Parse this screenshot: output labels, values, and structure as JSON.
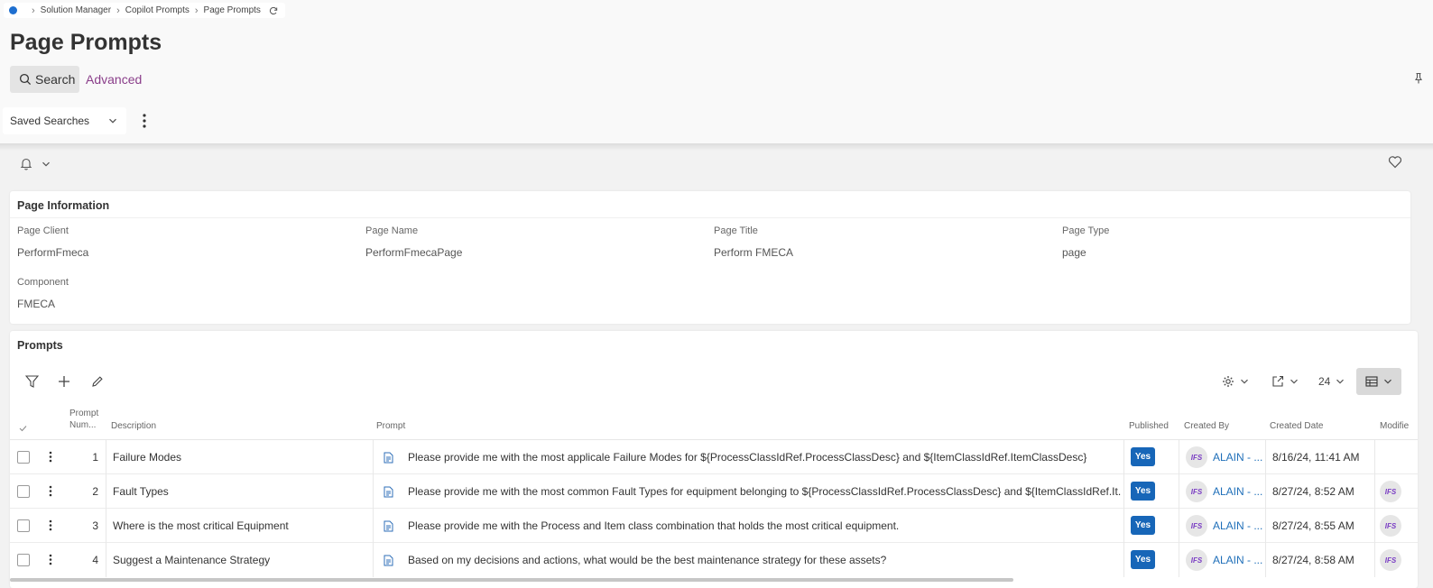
{
  "breadcrumb": {
    "items": [
      "Solution Manager",
      "Copilot Prompts",
      "Page Prompts"
    ]
  },
  "page": {
    "title": "Page Prompts"
  },
  "search": {
    "search_label": "Search",
    "advanced_label": "Advanced",
    "saved_searches_label": "Saved Searches"
  },
  "page_information": {
    "section_title": "Page Information",
    "fields": [
      {
        "label": "Page Client",
        "value": "PerformFmeca"
      },
      {
        "label": "Page Name",
        "value": "PerformFmecaPage"
      },
      {
        "label": "Page Title",
        "value": "Perform FMECA"
      },
      {
        "label": "Page Type",
        "value": "page"
      },
      {
        "label": "Component",
        "value": "FMECA"
      }
    ]
  },
  "prompts": {
    "section_title": "Prompts",
    "page_size": "24",
    "columns": {
      "prompt_number": "Prompt Num...",
      "description": "Description",
      "prompt": "Prompt",
      "published": "Published",
      "created_by": "Created By",
      "created_date": "Created Date",
      "modified": "Modifie"
    },
    "rows": [
      {
        "num": "1",
        "description": "Failure Modes",
        "prompt": "Please provide me with the most applicale Failure Modes for ${ProcessClassIdRef.ProcessClassDesc} and ${ItemClassIdRef.ItemClassDesc}",
        "published": "Yes",
        "avatar": "IFS",
        "created_by": "ALAIN - ...",
        "created_date": "8/16/24, 11:41 AM",
        "modified_avatar": ""
      },
      {
        "num": "2",
        "description": "Fault Types",
        "prompt": "Please provide me with the most common Fault Types for equipment belonging to ${ProcessClassIdRef.ProcessClassDesc} and ${ItemClassIdRef.It...",
        "published": "Yes",
        "avatar": "IFS",
        "created_by": "ALAIN - ...",
        "created_date": "8/27/24, 8:52 AM",
        "modified_avatar": "IFS"
      },
      {
        "num": "3",
        "description": "Where is the most critical Equipment",
        "prompt": "Please provide me with the Process and Item class combination that holds the most critical equipment.",
        "published": "Yes",
        "avatar": "IFS",
        "created_by": "ALAIN - ...",
        "created_date": "8/27/24, 8:55 AM",
        "modified_avatar": "IFS"
      },
      {
        "num": "4",
        "description": "Suggest a Maintenance Strategy",
        "prompt": "Based on my decisions and actions, what would be the best maintenance strategy for these assets?",
        "published": "Yes",
        "avatar": "IFS",
        "created_by": "ALAIN - ...",
        "created_date": "8/27/24, 8:58 AM",
        "modified_avatar": "IFS"
      }
    ]
  },
  "colors": {
    "published_badge": "#1766b8",
    "link": "#1f6fb9",
    "advanced_link": "#8a3e8a",
    "breadcrumb_dot": "#1e6fd0",
    "avatar_text": "#7b3fc4"
  },
  "icons": [
    "home-dot-icon",
    "chevron-right-icon",
    "refresh-icon",
    "search-icon",
    "pin-icon",
    "chevron-down-icon",
    "kebab-icon",
    "bell-icon",
    "heart-icon",
    "filter-icon",
    "plus-icon",
    "pencil-icon",
    "gear-icon",
    "export-icon",
    "table-icon",
    "check-icon",
    "document-icon"
  ]
}
